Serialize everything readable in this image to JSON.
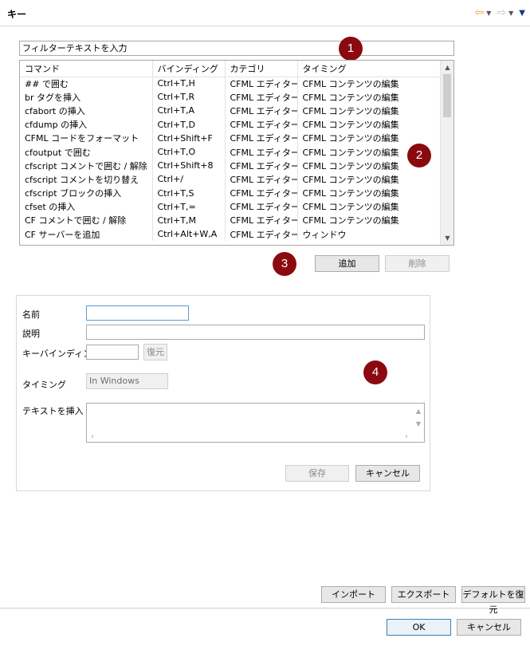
{
  "window": {
    "title": "キー"
  },
  "filter": {
    "placeholder": "フィルターテキストを入力"
  },
  "table": {
    "headers": [
      "コマンド",
      "バインディング",
      "カテゴリ",
      "タイミング"
    ],
    "rows": [
      [
        "## で囲む",
        "Ctrl+T,H",
        "CFML エディター",
        "CFML コンテンツの編集"
      ],
      [
        "br タグを挿入",
        "Ctrl+T,R",
        "CFML エディター",
        "CFML コンテンツの編集"
      ],
      [
        "cfabort の挿入",
        "Ctrl+T,A",
        "CFML エディター",
        "CFML コンテンツの編集"
      ],
      [
        "cfdump の挿入",
        "Ctrl+T,D",
        "CFML エディター",
        "CFML コンテンツの編集"
      ],
      [
        "CFML コードをフォーマット",
        "Ctrl+Shift+F",
        "CFML エディター",
        "CFML コンテンツの編集"
      ],
      [
        "cfoutput で囲む",
        "Ctrl+T,O",
        "CFML エディター",
        "CFML コンテンツの編集"
      ],
      [
        "cfscript コメントで囲む / 解除",
        "Ctrl+Shift+8",
        "CFML エディター",
        "CFML コンテンツの編集"
      ],
      [
        "cfscript コメントを切り替え",
        "Ctrl+/",
        "CFML エディター",
        "CFML コンテンツの編集"
      ],
      [
        "cfscript ブロックの挿入",
        "Ctrl+T,S",
        "CFML エディター",
        "CFML コンテンツの編集"
      ],
      [
        "cfset の挿入",
        "Ctrl+T,=",
        "CFML エディター",
        "CFML コンテンツの編集"
      ],
      [
        "CF コメントで囲む / 解除",
        "Ctrl+T,M",
        "CFML エディター",
        "CFML コンテンツの編集"
      ],
      [
        "CF サーバーを追加",
        "Ctrl+Alt+W,A",
        "CFML エディター",
        "ウィンドウ"
      ]
    ]
  },
  "badges": [
    "1",
    "2",
    "3",
    "4"
  ],
  "buttons": {
    "add": "追加",
    "delete": "削除",
    "save": "保存",
    "cancel": "キャンセル",
    "restore": "復元"
  },
  "editor": {
    "name_label": "名前",
    "name_value": "",
    "description_label": "説明",
    "description_value": "",
    "keybinding_label": "キーバインディング",
    "keybinding_value": "",
    "timing_label": "タイミング",
    "timing_value": "In Windows",
    "insert_text_label": "テキストを挿入"
  },
  "footer": {
    "import": "インポート",
    "export": "エクスポート",
    "restore_defaults": "デフォルトを復元",
    "ok": "OK",
    "cancel": "キャンセル"
  },
  "colors": {
    "badge": "#8b0a0f",
    "back_arrow": "#e6a13a"
  }
}
